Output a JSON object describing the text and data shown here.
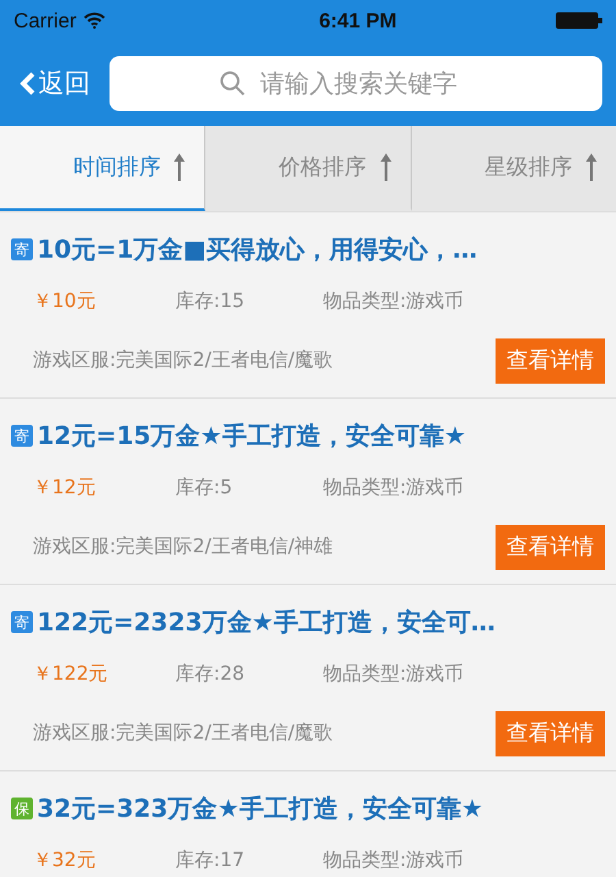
{
  "status_bar": {
    "carrier": "Carrier",
    "time": "6:41 PM"
  },
  "nav": {
    "back": "返回",
    "search": {
      "placeholder": "请输入搜索关键字"
    }
  },
  "tabs": [
    {
      "label": "时间排序",
      "selected": true
    },
    {
      "label": "价格排序",
      "selected": false
    },
    {
      "label": "星级排序",
      "selected": false
    }
  ],
  "items": [
    {
      "badge": "寄",
      "color": "#2e8be0",
      "title": "10元=1万金■买得放心，用得安心，…",
      "price": "￥10元",
      "stock": "库存:15",
      "type": "物品类型:游戏币",
      "server": "游戏区服:完美国际2/王者电信/魔歌",
      "button": "查看详情"
    },
    {
      "badge": "寄",
      "color": "#2e8be0",
      "title": "12元=15万金★手工打造，安全可靠★",
      "price": "￥12元",
      "stock": "库存:5",
      "type": "物品类型:游戏币",
      "server": "游戏区服:完美国际2/王者电信/神雄",
      "button": "查看详情"
    },
    {
      "badge": "寄",
      "color": "#2e8be0",
      "title": "122元=2323万金★手工打造，安全可…",
      "price": "￥122元",
      "stock": "库存:28",
      "type": "物品类型:游戏币",
      "server": "游戏区服:完美国际2/王者电信/魔歌",
      "button": "查看详情"
    },
    {
      "badge": "保",
      "color": "#5fb32f",
      "title": "32元=323万金★手工打造，安全可靠★",
      "price": "￥32元",
      "stock": "库存:17",
      "type": "物品类型:游戏币"
    }
  ]
}
